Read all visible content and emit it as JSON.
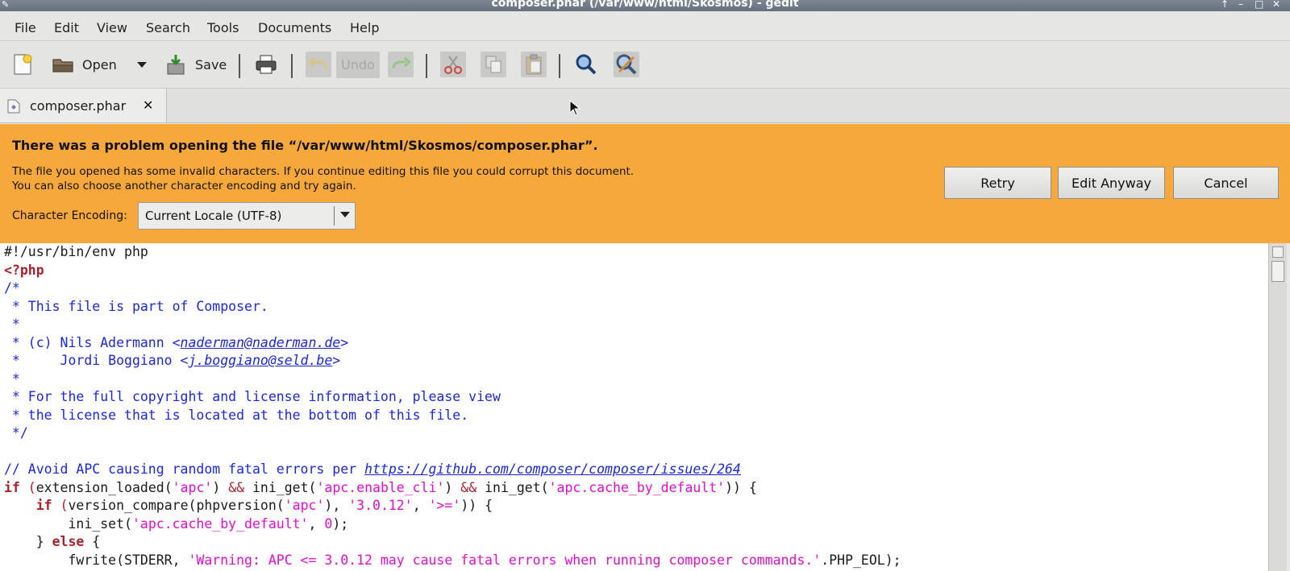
{
  "window": {
    "title": "composer.phar (/var/www/html/Skosmos) - gedit",
    "controls": [
      "↑",
      "–",
      "□",
      "✕"
    ]
  },
  "menu": [
    "File",
    "Edit",
    "View",
    "Search",
    "Tools",
    "Documents",
    "Help"
  ],
  "toolbar": {
    "open_label": "Open",
    "save_label": "Save",
    "undo_label": "Undo"
  },
  "tab": {
    "label": "composer.phar",
    "close": "✕"
  },
  "infobar": {
    "title": "There was a problem opening the file “/var/www/html/Skosmos/composer.phar”.",
    "message_line1": "The file you opened has some invalid characters. If you continue editing this file you could corrupt this document.",
    "message_line2": "You can also choose another character encoding and try again.",
    "encoding_label": "Character Encoding:",
    "encoding_value": "Current Locale (UTF-8)",
    "buttons": {
      "retry": "Retry",
      "edit_anyway": "Edit Anyway",
      "cancel": "Cancel"
    }
  },
  "editor": {
    "lines": [
      [
        {
          "t": "#!/usr/bin/env php",
          "c": ""
        }
      ],
      [
        {
          "t": "<?php",
          "c": "c-kw"
        }
      ],
      [
        {
          "t": "/*",
          "c": "c-cm"
        }
      ],
      [
        {
          "t": " * This file is part of Composer.",
          "c": "c-cm"
        }
      ],
      [
        {
          "t": " *",
          "c": "c-cm"
        }
      ],
      [
        {
          "t": " * (c) Nils Adermann <",
          "c": "c-cm"
        },
        {
          "t": "naderman@naderman.de",
          "c": "c-link"
        },
        {
          "t": ">",
          "c": "c-cm"
        }
      ],
      [
        {
          "t": " *     Jordi Boggiano <",
          "c": "c-cm"
        },
        {
          "t": "j.boggiano@seld.be",
          "c": "c-link"
        },
        {
          "t": ">",
          "c": "c-cm"
        }
      ],
      [
        {
          "t": " *",
          "c": "c-cm"
        }
      ],
      [
        {
          "t": " * For the full copyright and license information, please view",
          "c": "c-cm"
        }
      ],
      [
        {
          "t": " * the license that is located at the bottom of this file.",
          "c": "c-cm"
        }
      ],
      [
        {
          "t": " */",
          "c": "c-cm"
        }
      ],
      [
        {
          "t": "",
          "c": ""
        }
      ],
      [
        {
          "t": "// Avoid APC causing random fatal errors per ",
          "c": "c-cm"
        },
        {
          "t": "https://github.com/composer/composer/issues/264",
          "c": "c-link"
        }
      ],
      [
        {
          "t": "if",
          "c": "c-kw"
        },
        {
          "t": " (",
          "c": "c-punc"
        },
        {
          "t": "extension_loaded(",
          "c": ""
        },
        {
          "t": "'apc'",
          "c": "c-str"
        },
        {
          "t": ") ",
          "c": ""
        },
        {
          "t": "&&",
          "c": "c-punc"
        },
        {
          "t": " ini_get(",
          "c": ""
        },
        {
          "t": "'apc.enable_cli'",
          "c": "c-str"
        },
        {
          "t": ") ",
          "c": ""
        },
        {
          "t": "&&",
          "c": "c-punc"
        },
        {
          "t": " ini_get(",
          "c": ""
        },
        {
          "t": "'apc.cache_by_default'",
          "c": "c-str"
        },
        {
          "t": ")) {",
          "c": ""
        }
      ],
      [
        {
          "t": "    ",
          "c": ""
        },
        {
          "t": "if",
          "c": "c-kw"
        },
        {
          "t": " (",
          "c": "c-punc"
        },
        {
          "t": "version_compare(phpversion(",
          "c": ""
        },
        {
          "t": "'apc'",
          "c": "c-str"
        },
        {
          "t": "), ",
          "c": ""
        },
        {
          "t": "'3.0.12'",
          "c": "c-str"
        },
        {
          "t": ", ",
          "c": ""
        },
        {
          "t": "'>='",
          "c": "c-str"
        },
        {
          "t": ")) {",
          "c": ""
        }
      ],
      [
        {
          "t": "        ini_set(",
          "c": ""
        },
        {
          "t": "'apc.cache_by_default'",
          "c": "c-str"
        },
        {
          "t": ", ",
          "c": ""
        },
        {
          "t": "0",
          "c": "c-str"
        },
        {
          "t": ");",
          "c": ""
        }
      ],
      [
        {
          "t": "    } ",
          "c": ""
        },
        {
          "t": "else",
          "c": "c-kw"
        },
        {
          "t": " {",
          "c": ""
        }
      ],
      [
        {
          "t": "        fwrite(STDERR, ",
          "c": ""
        },
        {
          "t": "'Warning: APC <= 3.0.12 may cause fatal errors when running composer commands.'",
          "c": "c-str"
        },
        {
          "t": ".PHP_EOL);",
          "c": ""
        }
      ]
    ]
  }
}
